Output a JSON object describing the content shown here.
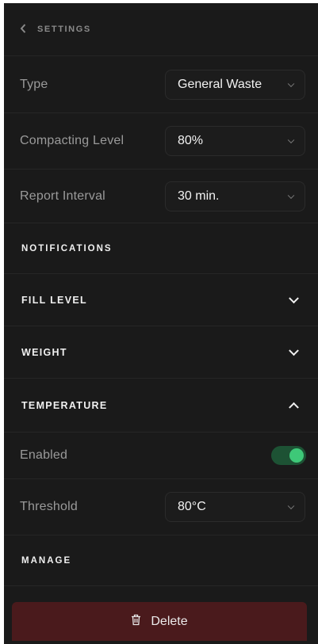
{
  "header": {
    "back_icon": "chevron-left-icon",
    "title": "SETTINGS"
  },
  "fields": {
    "type": {
      "label": "Type",
      "value": "General Waste"
    },
    "compacting": {
      "label": "Compacting Level",
      "value": "80%"
    },
    "report": {
      "label": "Report Interval",
      "value": "30 min."
    }
  },
  "notifications": {
    "title": "NOTIFICATIONS",
    "fill_level": {
      "label": "FILL LEVEL",
      "expanded": false
    },
    "weight": {
      "label": "WEIGHT",
      "expanded": false
    },
    "temperature": {
      "label": "TEMPERATURE",
      "expanded": true,
      "enabled_label": "Enabled",
      "enabled": true,
      "threshold_label": "Threshold",
      "threshold_value": "80°C"
    }
  },
  "manage": {
    "title": "MANAGE",
    "delete_label": "Delete",
    "delete_icon": "trash-icon"
  },
  "colors": {
    "panel": "#1a1a1a",
    "toggle_on": "#3ec878",
    "delete_bg": "#4a1a1c"
  }
}
